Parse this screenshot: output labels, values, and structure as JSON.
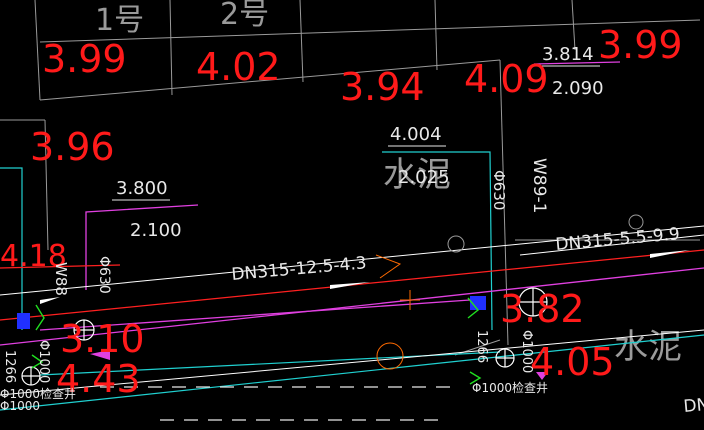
{
  "colors": {
    "background": "#000000",
    "elevation_text": "#ff1a1a",
    "annotation_text": "#e8e8e8",
    "building_outline": "#9a9a9a",
    "pipe_red": "#ff2020",
    "pipe_magenta": "#e040e0",
    "pipe_cyan": "#20d0d0",
    "pipe_white": "#ffffff",
    "fitting_green": "#20e020",
    "marker_blue": "#2030ff",
    "leader_orange": "#ff6a00"
  },
  "building_labels": {
    "bldg1": "1号",
    "bldg2": "2号"
  },
  "ground_elevations": {
    "e1": "3.99",
    "e2": "4.02",
    "e3": "3.94",
    "e4": "4.09",
    "e5": "3.99",
    "e6": "3.96",
    "e7": "3.82",
    "e8": "3.10",
    "e9": "3.80",
    "e10": "4.43",
    "e11": "4.05",
    "e12": "4.18"
  },
  "level_marks": {
    "a_top": "3.814",
    "a_bottom": "2.090",
    "b_top": "4.004",
    "b_bottom": "2.025",
    "c_top": "3.800",
    "c_bottom": "2.100"
  },
  "pipes": {
    "main": "DN315-12.5-4.3",
    "right": "DN315-5.5-9.9",
    "edge": "DN"
  },
  "wells": {
    "w1": "W89-1",
    "w2": "W88",
    "d1": "Φ630",
    "d2": "Φ630",
    "d3": "Φ1000检查井",
    "d4": "Φ1000检查井",
    "d5": "Φ1000",
    "d6": "Φ1000",
    "d7": "Φ1000",
    "d8": "1266",
    "d9": "1266"
  },
  "surface": {
    "s1": "水泥",
    "s2": "水泥"
  }
}
